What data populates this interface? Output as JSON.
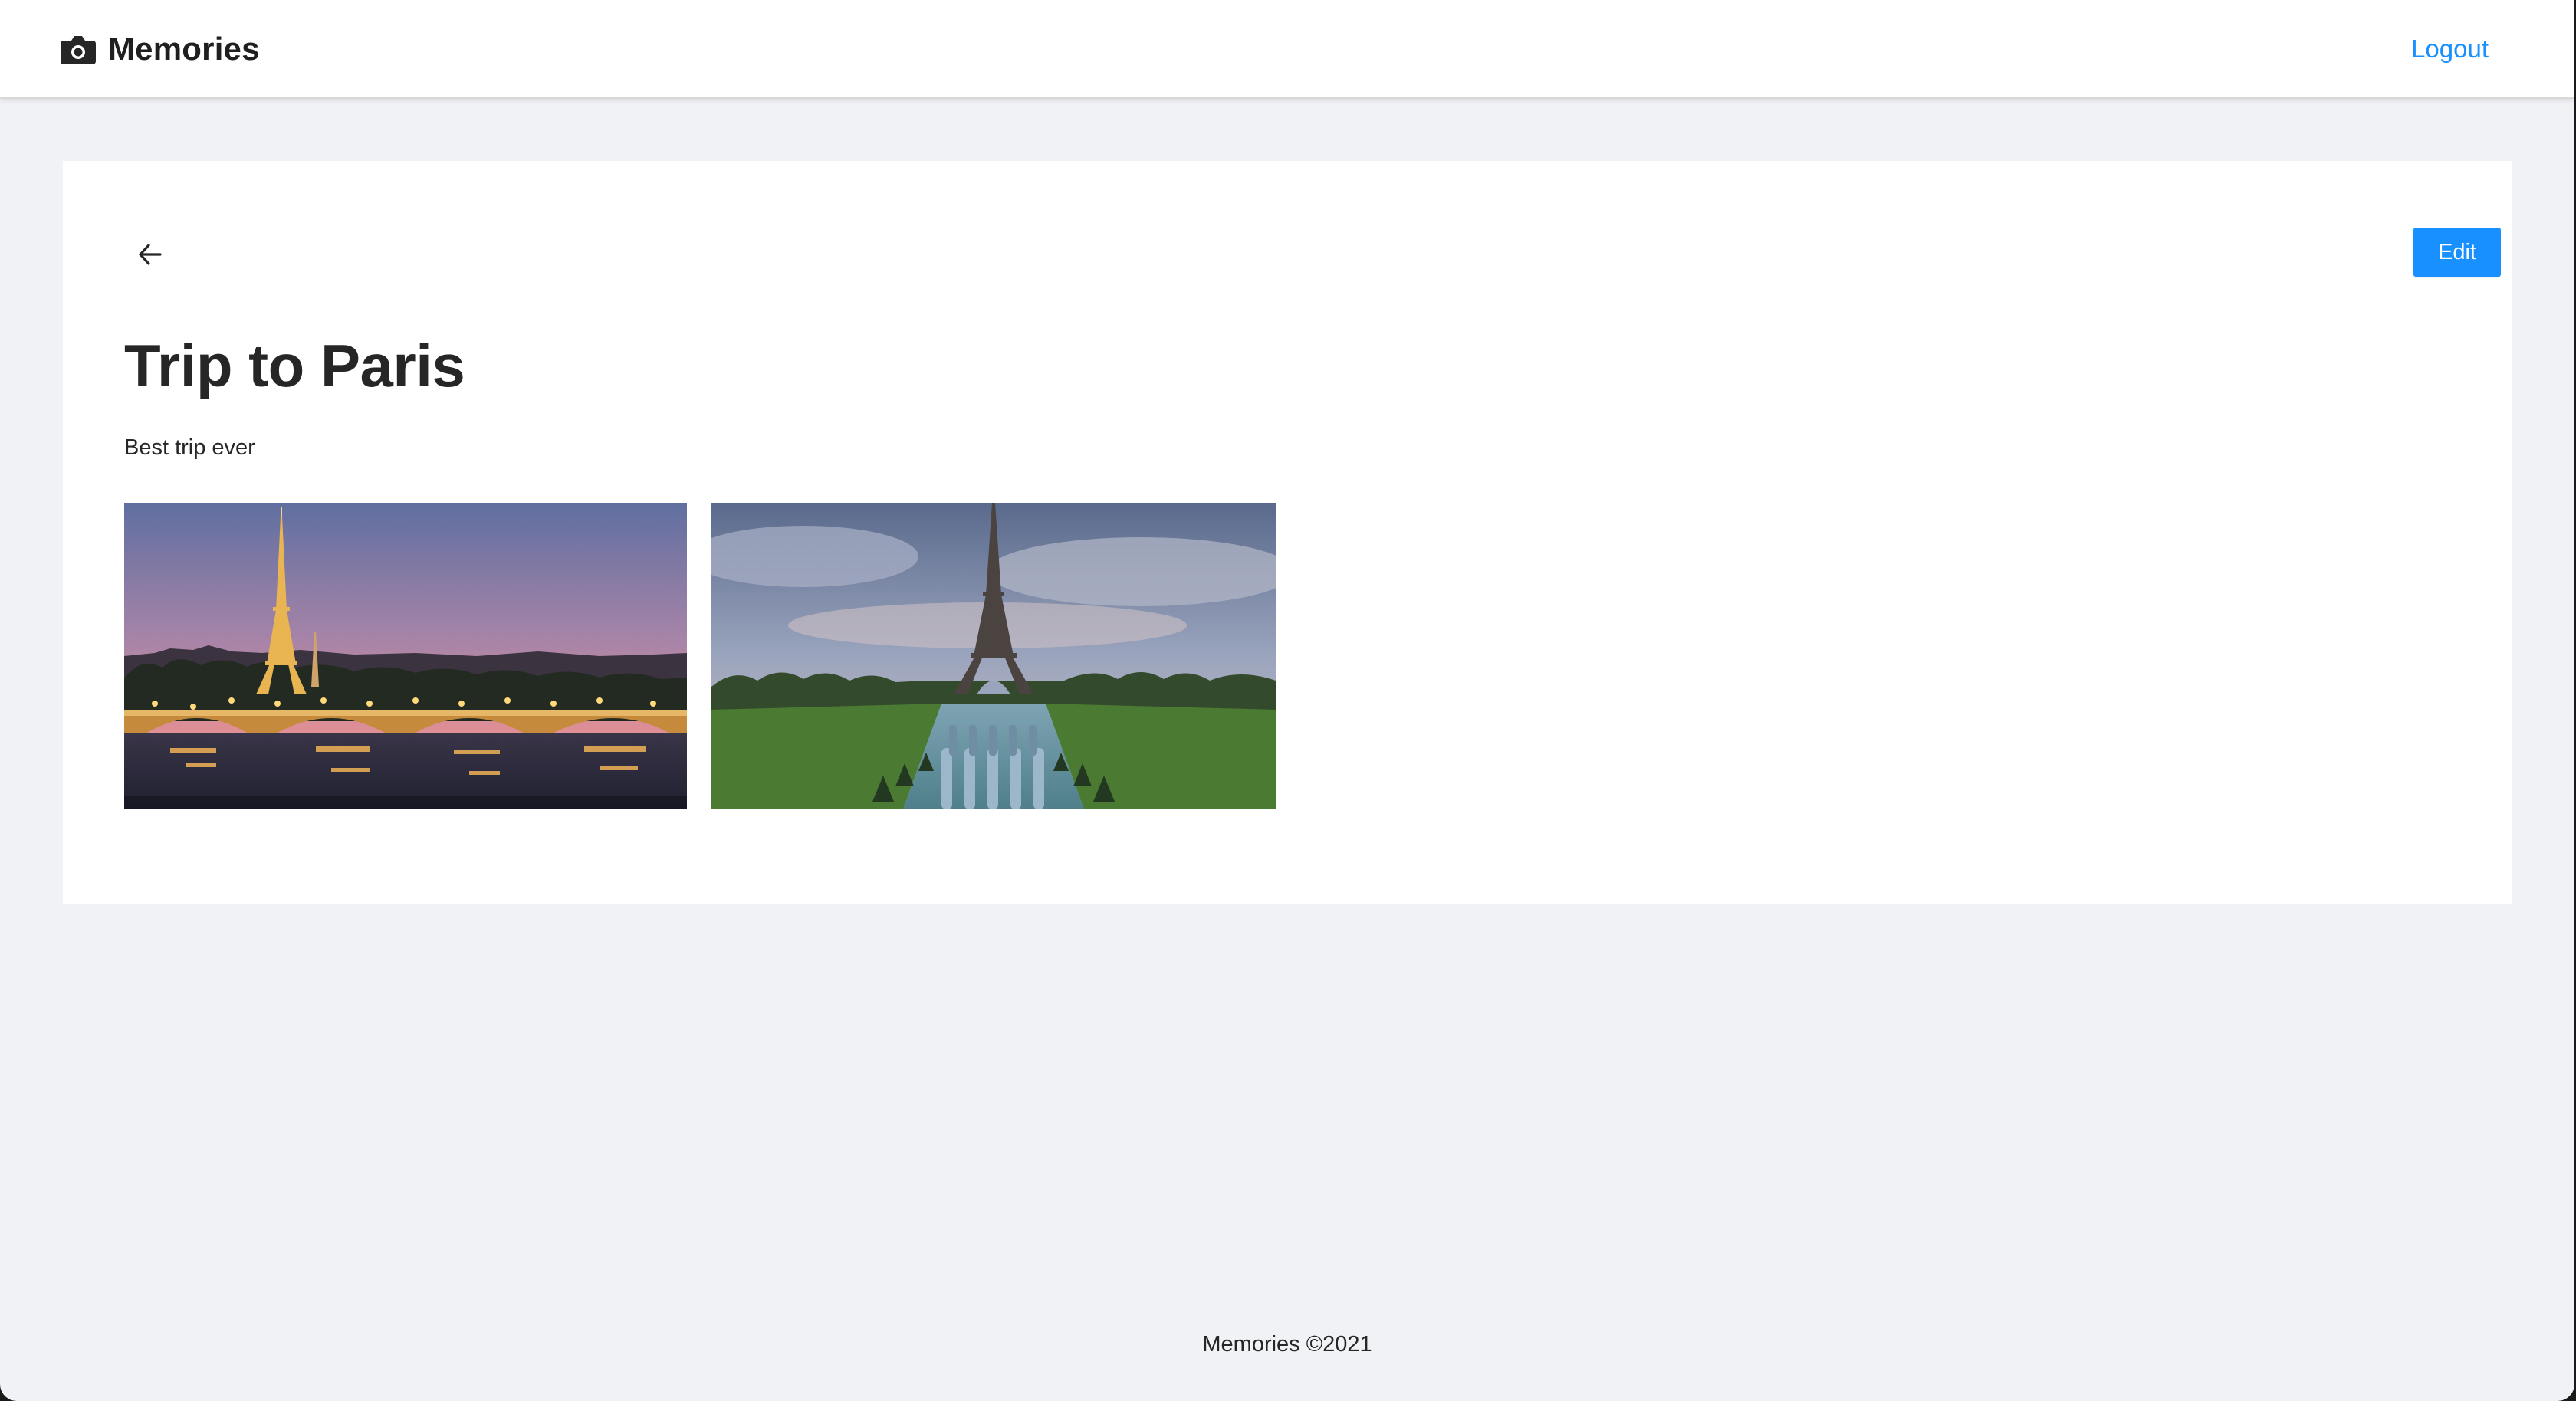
{
  "header": {
    "brand_icon": "camera-icon",
    "brand_name": "Memories",
    "logout_label": "Logout"
  },
  "memory": {
    "back_icon": "arrow-left-icon",
    "edit_label": "Edit",
    "title": "Trip to Paris",
    "description": "Best trip ever",
    "photos": [
      {
        "subject": "Eiffel Tower at dusk with illuminated bridge over the Seine"
      },
      {
        "subject": "Eiffel Tower viewed from Trocadéro fountains under cloudy sky"
      }
    ]
  },
  "footer": {
    "text": "Memories ©2021"
  },
  "colors": {
    "accent": "#1890ff",
    "background": "#f0f2f5",
    "card": "#ffffff",
    "text": "#262626"
  }
}
